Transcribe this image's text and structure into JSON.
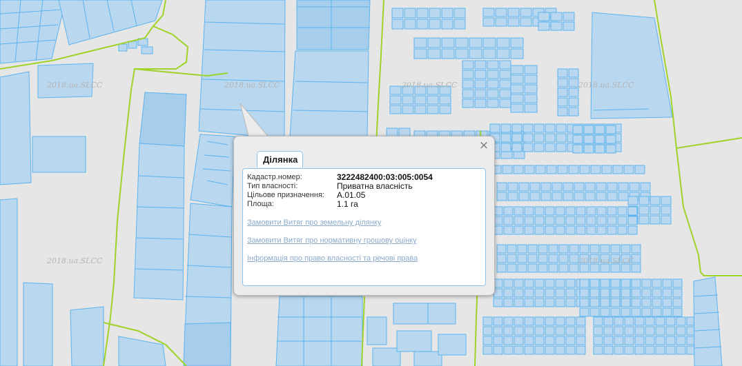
{
  "map": {
    "watermark": "2018.ua.SLCC",
    "colors": {
      "background": "#e6e6e6",
      "parcel_fill": "#b9d7ef",
      "parcel_stroke": "#5cb3ee",
      "boundary": "#9fd329"
    }
  },
  "popup": {
    "tab_label": "Ділянка",
    "close_icon": "×",
    "fields": [
      {
        "label": "Кадастр.номер:",
        "value": "3222482400:03:005:0054"
      },
      {
        "label": "Тип власності:",
        "value": "Приватна власність"
      },
      {
        "label": "Цільове призначення:",
        "value": "А.01.05"
      },
      {
        "label": "Площа:",
        "value": "1.1 га"
      }
    ],
    "links": [
      "Замовити Витяг про земельну ділянку",
      "Замовити Витяг про нормативну грошову оцінку",
      "Інформація про право власності та речові права"
    ]
  }
}
